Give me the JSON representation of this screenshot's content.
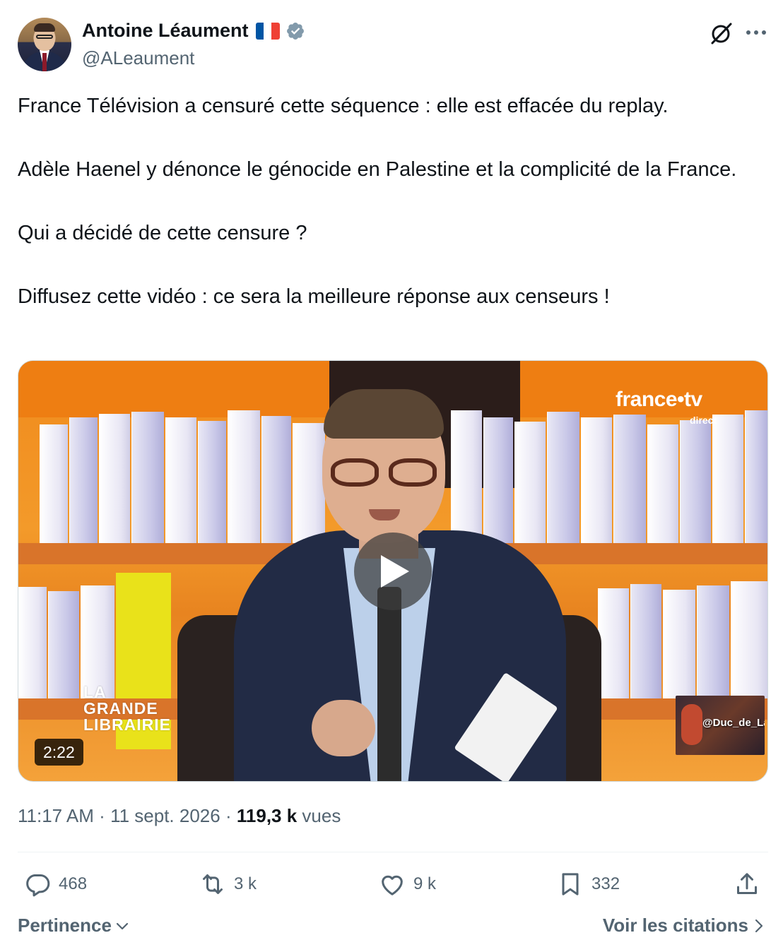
{
  "author": {
    "name": "Antoine Léaument",
    "handle": "@ALeaument",
    "flag": "france-flag",
    "badge": "verified-badge-icon",
    "badge_color": "#829aab"
  },
  "header_icons": [
    "grok-icon",
    "more-icon"
  ],
  "tweet": {
    "text": "France Télévision a censuré cette séquence : elle est effacée du replay.\n\nAdèle Haenel y dénonce le génocide en Palestine et la complicité de la France.\n\nQui a décidé de cette censure ?\n\nDiffusez cette vidéo : ce sera la meilleure réponse aux censeurs !"
  },
  "video": {
    "duration": "2:22",
    "channel_logo": "france•tv",
    "channel_sub": "direct",
    "show_logo": "LA GRANDE LIBRAIRIE",
    "watermark": "@Duc_de_Lajoie"
  },
  "meta": {
    "time": "11:17 AM",
    "date": "11 sept. 2026",
    "separator": "·",
    "views_count": "119,3 k",
    "views_label": "vues"
  },
  "actions": {
    "replies": "468",
    "reposts": "3 k",
    "likes": "9 k",
    "bookmarks": "332"
  },
  "footer": {
    "sort_label": "Pertinence",
    "quotes_label": "Voir les citations"
  },
  "colors": {
    "text_primary": "#0f1419",
    "text_secondary": "#536471",
    "flag_blue": "#0055a4",
    "flag_red": "#ef4135"
  }
}
